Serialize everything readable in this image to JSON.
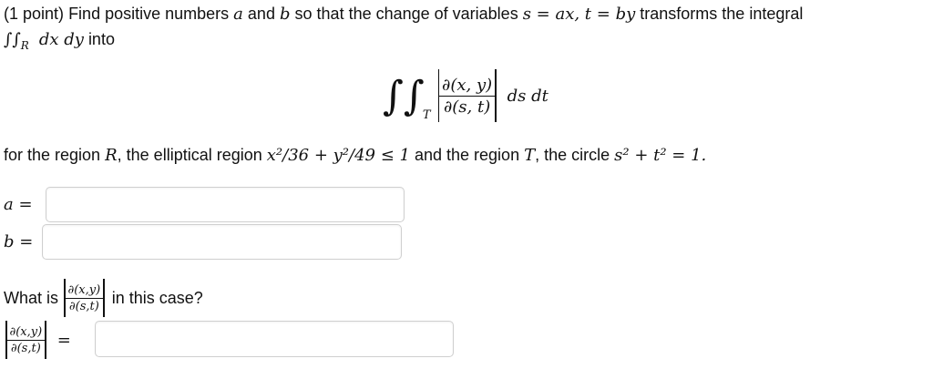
{
  "problem": {
    "points": "(1 point)",
    "intro": "Find positive numbers",
    "var_a": "a",
    "and": "and",
    "var_b": "b",
    "so_that": "so that the change of variables",
    "s_def": "s = ax, t = by",
    "transforms": "transforms the integral",
    "integral_small": "∫∫",
    "region_R": "R",
    "dxdy": "dx dy",
    "into": "into"
  },
  "display_integral": {
    "integrals": "∫∫",
    "region_T": "T",
    "numerator": "∂(x, y)",
    "denominator": "∂(s, t)",
    "dsdt": "ds dt"
  },
  "region_text": {
    "lead": "for the region",
    "R": "R",
    "mid": ", the elliptical region",
    "ellipse": "x²/36 + y²/49 ≤ 1",
    "and_region": "and the region",
    "T": "T",
    "circle_lead": ", the circle",
    "circle": "s² + t² = 1."
  },
  "answers": {
    "a_label": "a =",
    "a_value": "",
    "b_label": "b =",
    "b_value": "",
    "jac_value": ""
  },
  "question": {
    "what_is": "What is",
    "num": "∂(x,y)",
    "den": "∂(s,t)",
    "in_case": "in this case?",
    "eq": "="
  }
}
